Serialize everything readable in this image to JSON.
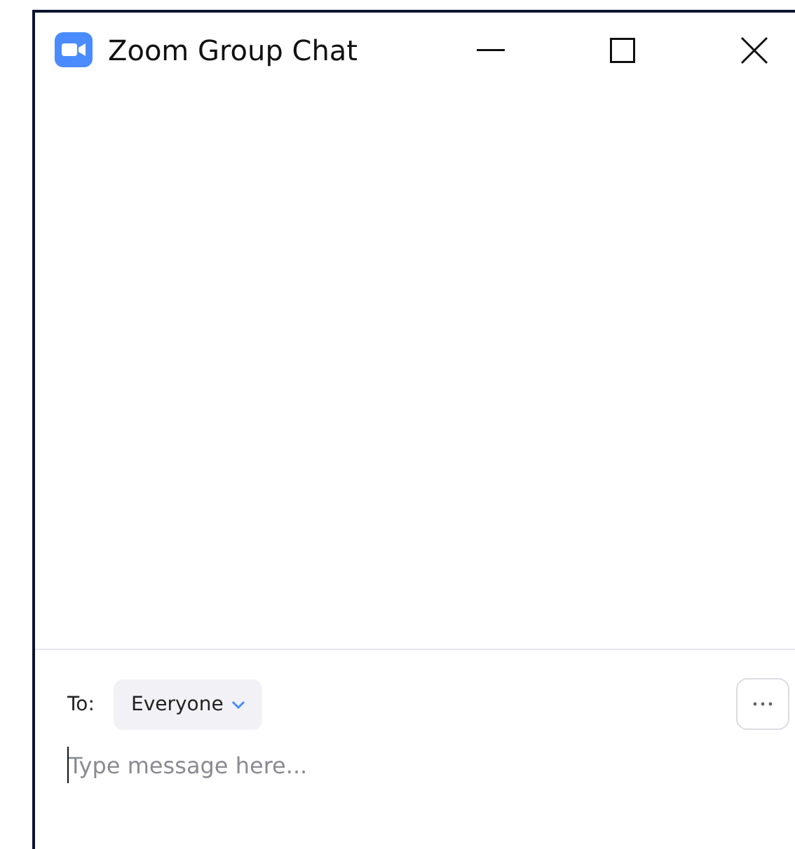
{
  "window": {
    "title": "Zoom Group Chat"
  },
  "composer": {
    "to_label": "To:",
    "recipient": "Everyone",
    "message": {
      "placeholder": "Type message here..."
    }
  }
}
